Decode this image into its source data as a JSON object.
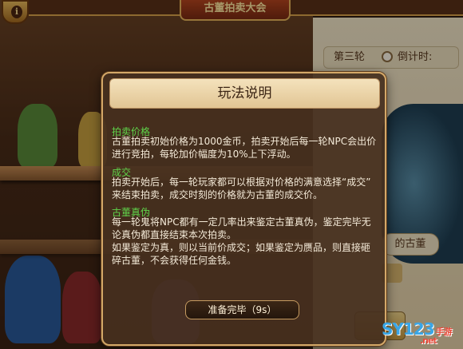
{
  "title_bar": {
    "label": "古董拍卖大会"
  },
  "info_button": {
    "glyph": "i"
  },
  "right_panel": {
    "round_label": "第三轮",
    "countdown_label": "倒计时:",
    "antique_label": "的古董"
  },
  "modal": {
    "title": "玩法说明",
    "sections": [
      {
        "heading": "拍卖价格",
        "lines": [
          "古董拍卖初始价格为1000金币，拍卖开始后每一轮NPC会出价",
          "进行竞拍，每轮加价幅度为10%上下浮动。"
        ]
      },
      {
        "heading": "成交",
        "lines": [
          "拍卖开始后，每一轮玩家都可以根据对价格的满意选择“成交”",
          "来结束拍卖，成交时刻的价格就为古董的成交价。"
        ]
      },
      {
        "heading": "古董真伪",
        "lines": [
          "每一轮鬼将NPC都有一定几率出来鉴定古董真伪，鉴定完毕无",
          "论真伪都直接结束本次拍卖。",
          "如果鉴定为真，则以当前价成交；如果鉴定为赝品，则直接砸",
          "碎古董，不会获得任何金钱。"
        ]
      }
    ],
    "ready_button": "准备完毕（9s）"
  },
  "watermark": {
    "main": "SY123",
    "suffix": "手游",
    "net": ".net"
  },
  "colors": {
    "section_heading": "#5fd44a",
    "body_text": "#f4ead8",
    "modal_bg": "#46301e",
    "title_bg": "#f4e2bc"
  }
}
